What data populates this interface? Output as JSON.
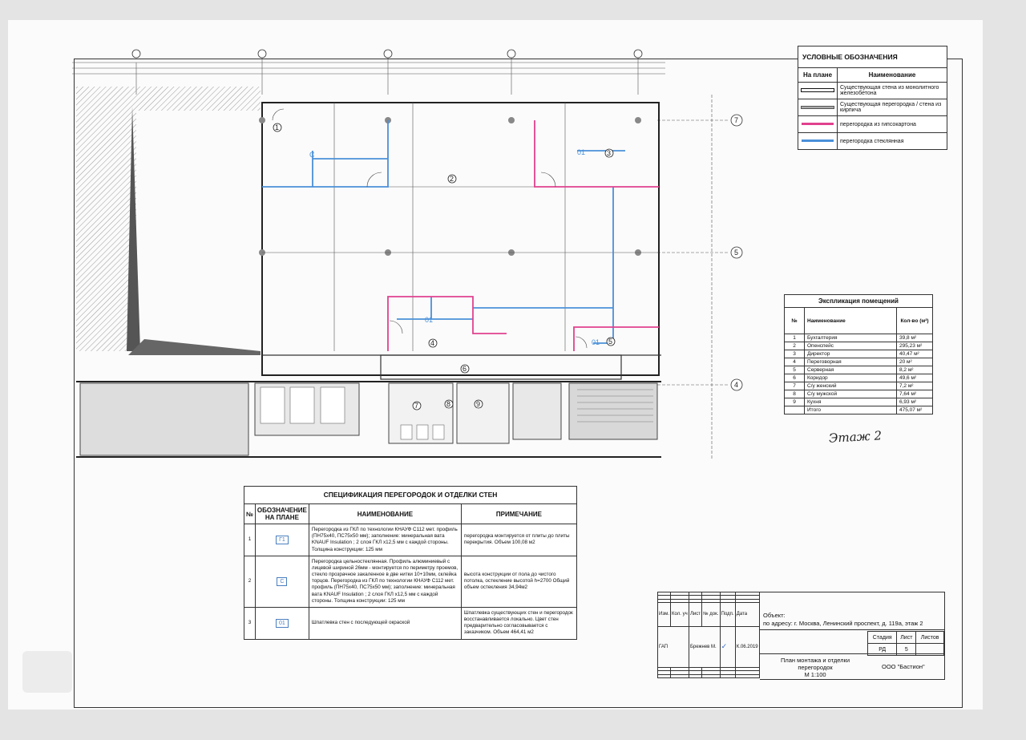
{
  "legend": {
    "title": "УСЛОВНЫЕ ОБОЗНАЧЕНИЯ",
    "col_plan": "На плане",
    "col_name": "Наименование",
    "items": [
      {
        "label": "Существующая стена из монолитного железобетона",
        "color": "#111111"
      },
      {
        "label": "Существующая перегородка / стена из кирпича",
        "color": "#555555"
      },
      {
        "label": "перегородка из гипсокартона",
        "color": "#e0418e"
      },
      {
        "label": "перегородка стеклянная",
        "color": "#4a90d9"
      }
    ]
  },
  "explication": {
    "title": "Экспликация помещений",
    "col_no": "№",
    "col_name": "Наименование",
    "col_qty": "Кол-во (м²)",
    "rows": [
      {
        "no": "1",
        "name": "Бухгалтерия",
        "qty": "39,8 м²"
      },
      {
        "no": "2",
        "name": "Опенспейс",
        "qty": "295,23 м²"
      },
      {
        "no": "3",
        "name": "Директор",
        "qty": "40,47 м²"
      },
      {
        "no": "4",
        "name": "Переговорная",
        "qty": "20 м²"
      },
      {
        "no": "5",
        "name": "Серверная",
        "qty": "8,2 м²"
      },
      {
        "no": "6",
        "name": "Коридор",
        "qty": "49,6 м²"
      },
      {
        "no": "7",
        "name": "С/у женский",
        "qty": "7,2 м²"
      },
      {
        "no": "8",
        "name": "С/у мужской",
        "qty": "7,64 м²"
      },
      {
        "no": "9",
        "name": "Кухня",
        "qty": "6,93 м²"
      }
    ],
    "total_label": "Итого",
    "total_qty": "475,07 м²"
  },
  "handwritten_floor": "Этаж 2",
  "plan": {
    "rooms": [
      "1",
      "2",
      "3",
      "4",
      "5",
      "6",
      "7",
      "8",
      "9"
    ],
    "axes_top": [
      "",
      "",
      "",
      "",
      ""
    ],
    "axes_right": [
      "7",
      "5",
      "4"
    ],
    "glass_tag": "C",
    "finish_tag": "01"
  },
  "specification": {
    "title": "СПЕЦИФИКАЦИЯ ПЕРЕГОРОДОК И ОТДЕЛКИ СТЕН",
    "col_no": "№",
    "col_mark": "ОБОЗНАЧЕНИЕ НА ПЛАНЕ",
    "col_name": "НАИМЕНОВАНИЕ",
    "col_note": "ПРИМЕЧАНИЕ",
    "rows": [
      {
        "no": "1",
        "mark": "Г1",
        "name": "Перегородка из ГКЛ по технологии КНАУФ С112 мет. профиль (ПН75х40, ПС75х50 мм); заполнение: минеральная вата KNAUF Insulation ; 2 слоя ГКЛ х12,5 мм с каждой стороны. Толщина конструкции: 125 мм",
        "note": "перегородка монтируется от плиты до плиты перекрытия. Объем 100,08 м2"
      },
      {
        "no": "2",
        "mark": "С",
        "name": "Перегородка цельностеклянная. Профиль алюминиевый с лицевой шириной 26мм - монтируется по периметру проемов, стекло прозрачное закаленное в две нитки 10+10мм, склейка торцов. Перегородка из ГКЛ по технологии КНАУФ С112 мет. профиль (ПН75х40, ПС75х50 мм); заполнение: минеральная вата KNAUF Insulation ; 2 слоя ГКЛ х12,5 мм с каждой стороны. Толщина конструкции: 125 мм",
        "note": "высота конструкции от пола до чистого потолка, остекление высотой h=2700 Общий объем остекления 34,94м2"
      },
      {
        "no": "3",
        "mark": "01",
        "name": "Шпатлевка стен с последующей окраской",
        "note": "Шпатлевка существующих стен и перегородок восстанавливается локально. Цвет стен предварительно согласовывается с заказчиком. Объем 464,41 м2"
      }
    ]
  },
  "title_block": {
    "object_label": "Объект:",
    "object_address": "по адресу: г. Москва, Ленинский проспект, д. 119а, этаж 2",
    "h_izm": "Изм.",
    "h_kol": "Кол. уч",
    "h_list": "Лист",
    "h_doc": "№ док.",
    "h_sign": "Подп.",
    "h_date": "Дата",
    "role": "ГАП",
    "person": "Брежнев М.",
    "date": "К.06.2019",
    "stage_h": "Стадия",
    "sheet_h": "Лист",
    "sheets_h": "Листов",
    "stage": "РД",
    "sheet": "5",
    "sheets": "",
    "drawing_title": "План монтажа и отделки перегородок",
    "scale": "М 1:100",
    "org": "ООО \"Бастион\""
  }
}
